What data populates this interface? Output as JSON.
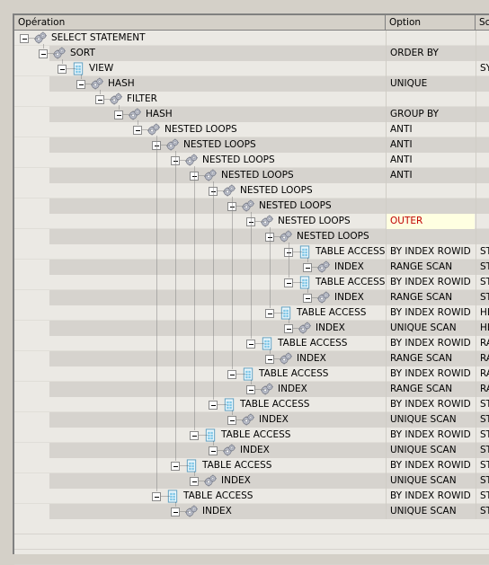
{
  "columns": [
    "Opération",
    "Option",
    "Sc"
  ],
  "colors": {
    "highlight_bg": "#ffffe1",
    "highlight_text": "#c00000",
    "row_dark": "#d6d3ce",
    "row_light": "#ebe9e4"
  },
  "rows": [
    {
      "operation": "SELECT STATEMENT",
      "depth": 0,
      "icon": "gear-icon",
      "option": "",
      "object": ""
    },
    {
      "operation": "SORT",
      "depth": 1,
      "icon": "gear-icon",
      "option": "ORDER BY",
      "object": ""
    },
    {
      "operation": "VIEW",
      "depth": 2,
      "icon": "table-icon",
      "option": "",
      "object": "SY"
    },
    {
      "operation": "HASH",
      "depth": 3,
      "icon": "gear-icon",
      "option": "UNIQUE",
      "object": ""
    },
    {
      "operation": "FILTER",
      "depth": 4,
      "icon": "gear-icon",
      "option": "",
      "object": ""
    },
    {
      "operation": "HASH",
      "depth": 5,
      "icon": "gear-icon",
      "option": "GROUP BY",
      "object": ""
    },
    {
      "operation": "NESTED LOOPS",
      "depth": 6,
      "icon": "gear-icon",
      "option": "ANTI",
      "object": ""
    },
    {
      "operation": "NESTED LOOPS",
      "depth": 7,
      "icon": "gear-icon",
      "option": "ANTI",
      "object": ""
    },
    {
      "operation": "NESTED LOOPS",
      "depth": 8,
      "icon": "gear-icon",
      "option": "ANTI",
      "object": ""
    },
    {
      "operation": "NESTED LOOPS",
      "depth": 9,
      "icon": "gear-icon",
      "option": "ANTI",
      "object": ""
    },
    {
      "operation": "NESTED LOOPS",
      "depth": 10,
      "icon": "gear-icon",
      "option": "",
      "object": ""
    },
    {
      "operation": "NESTED LOOPS",
      "depth": 11,
      "icon": "gear-icon",
      "option": "",
      "object": ""
    },
    {
      "operation": "NESTED LOOPS",
      "depth": 12,
      "icon": "gear-icon",
      "option": "OUTER",
      "object": "",
      "highlight": true
    },
    {
      "operation": "NESTED LOOPS",
      "depth": 13,
      "icon": "gear-icon",
      "option": "",
      "object": ""
    },
    {
      "operation": "TABLE ACCESS",
      "depth": 14,
      "icon": "table-icon",
      "option": "BY INDEX ROWID",
      "object": "ST"
    },
    {
      "operation": "INDEX",
      "depth": 15,
      "icon": "gear-icon",
      "option": "RANGE SCAN",
      "object": "ST"
    },
    {
      "operation": "TABLE ACCESS",
      "depth": 14,
      "icon": "table-icon",
      "option": "BY INDEX ROWID",
      "object": "ST"
    },
    {
      "operation": "INDEX",
      "depth": 15,
      "icon": "gear-icon",
      "option": "RANGE SCAN",
      "object": "ST"
    },
    {
      "operation": "TABLE ACCESS",
      "depth": 13,
      "icon": "table-icon",
      "option": "BY INDEX ROWID",
      "object": "HE"
    },
    {
      "operation": "INDEX",
      "depth": 14,
      "icon": "gear-icon",
      "option": "UNIQUE SCAN",
      "object": "HE"
    },
    {
      "operation": "TABLE ACCESS",
      "depth": 12,
      "icon": "table-icon",
      "option": "BY INDEX ROWID",
      "object": "RA"
    },
    {
      "operation": "INDEX",
      "depth": 13,
      "icon": "gear-icon",
      "option": "RANGE SCAN",
      "object": "RA"
    },
    {
      "operation": "TABLE ACCESS",
      "depth": 11,
      "icon": "table-icon",
      "option": "BY INDEX ROWID",
      "object": "RA"
    },
    {
      "operation": "INDEX",
      "depth": 12,
      "icon": "gear-icon",
      "option": "RANGE SCAN",
      "object": "RA"
    },
    {
      "operation": "TABLE ACCESS",
      "depth": 10,
      "icon": "table-icon",
      "option": "BY INDEX ROWID",
      "object": "ST"
    },
    {
      "operation": "INDEX",
      "depth": 11,
      "icon": "gear-icon",
      "option": "UNIQUE SCAN",
      "object": "ST"
    },
    {
      "operation": "TABLE ACCESS",
      "depth": 9,
      "icon": "table-icon",
      "option": "BY INDEX ROWID",
      "object": "ST"
    },
    {
      "operation": "INDEX",
      "depth": 10,
      "icon": "gear-icon",
      "option": "UNIQUE SCAN",
      "object": "ST"
    },
    {
      "operation": "TABLE ACCESS",
      "depth": 8,
      "icon": "table-icon",
      "option": "BY INDEX ROWID",
      "object": "ST"
    },
    {
      "operation": "INDEX",
      "depth": 9,
      "icon": "gear-icon",
      "option": "UNIQUE SCAN",
      "object": "ST"
    },
    {
      "operation": "TABLE ACCESS",
      "depth": 7,
      "icon": "table-icon",
      "option": "BY INDEX ROWID",
      "object": "ST"
    },
    {
      "operation": "INDEX",
      "depth": 8,
      "icon": "gear-icon",
      "option": "UNIQUE SCAN",
      "object": "ST"
    }
  ]
}
